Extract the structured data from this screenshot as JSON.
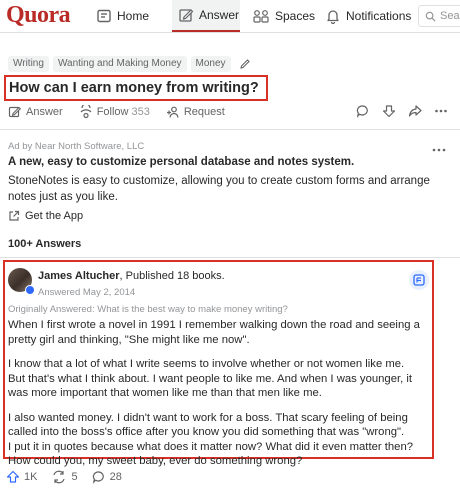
{
  "nav": {
    "logo": "Quora",
    "home_label": "Home",
    "answer_label": "Answer",
    "spaces_label": "Spaces",
    "notifications_label": "Notifications",
    "search_placeholder": "Searc"
  },
  "topics": [
    "Writing",
    "Wanting and Making Money",
    "Money"
  ],
  "question": {
    "title": "How can I earn money from writing?"
  },
  "actions": {
    "answer_label": "Answer",
    "follow_label": "Follow",
    "follow_count": "353",
    "request_label": "Request"
  },
  "ad": {
    "label": "Ad by Near North Software, LLC",
    "title": "A new, easy to customize personal database and notes system.",
    "body": "StoneNotes is easy to customize, allowing you to create custom forms and arrange notes just as you like.",
    "cta_label": "Get the App"
  },
  "answers_count": "100+ Answers",
  "answer": {
    "author_name": "James Altucher",
    "author_credential": ", Published 18 books.",
    "answered_date": "Answered May 2, 2014",
    "originally_answered": "Originally Answered: What is the best way to make money writing?",
    "paragraphs": [
      "When I first wrote a novel in 1991 I remember walking down the road and seeing a pretty girl and thinking, \"She might like me now\".",
      "I know that a lot of what I write seems to involve whether or not women like me.",
      "But that's what I think about. I want people to like me. And when I was younger, it was more important that women like me than that men like me.",
      "I also wanted money. I didn't want to work for a boss. That scary feeling of being called into the boss's office after you know you did something that was \"wrong\".",
      "I put it in quotes because what does it matter now? What did it even matter then?",
      "How could you, my sweet baby, ever do something wrong?"
    ]
  },
  "bottom_bar": {
    "upvote_count": "1K",
    "share_count": "5",
    "comment_count": "28"
  },
  "colors": {
    "brand": "#b92b27",
    "highlight_box": "#d93025",
    "verified": "#2e69ff"
  }
}
